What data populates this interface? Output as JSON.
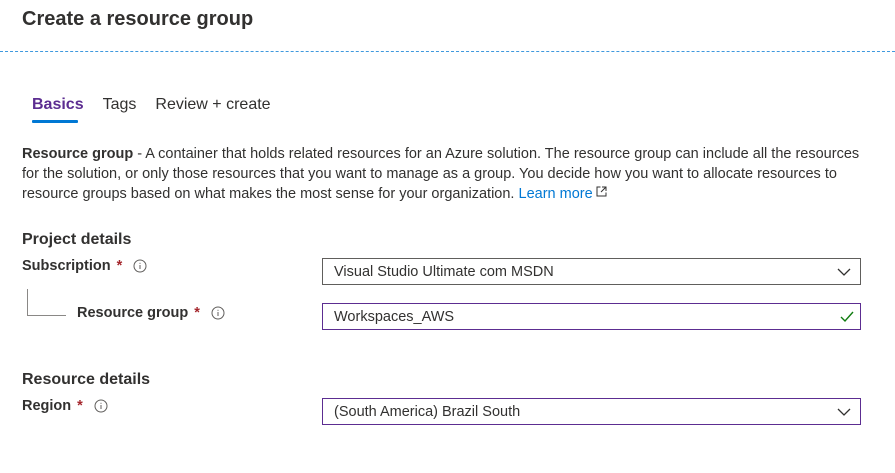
{
  "page": {
    "title": "Create a resource group"
  },
  "tabs": [
    {
      "label": "Basics",
      "active": true
    },
    {
      "label": "Tags",
      "active": false
    },
    {
      "label": "Review + create",
      "active": false
    }
  ],
  "description": {
    "term": "Resource group",
    "text": " - A container that holds related resources for an Azure solution. The resource group can include all the resources for the solution, or only those resources that you want to manage as a group. You decide how you want to allocate resources to resource groups based on what makes the most sense for your organization. ",
    "link_label": "Learn more"
  },
  "project_details": {
    "heading": "Project details",
    "subscription": {
      "label": "Subscription",
      "required_mark": "*",
      "value": "Visual Studio Ultimate com MSDN"
    },
    "resource_group": {
      "label": "Resource group",
      "required_mark": "*",
      "value": "Workspaces_AWS",
      "valid": true
    }
  },
  "resource_details": {
    "heading": "Resource details",
    "region": {
      "label": "Region",
      "required_mark": "*",
      "value": "(South America) Brazil South"
    }
  },
  "colors": {
    "accent_purple": "#5c2d91",
    "link_blue": "#0078d4",
    "required_red": "#a4262c",
    "valid_green": "#107c10",
    "text": "#323130"
  },
  "icons": [
    "info-icon",
    "chevron-down-icon",
    "checkmark-icon",
    "external-link-icon"
  ]
}
